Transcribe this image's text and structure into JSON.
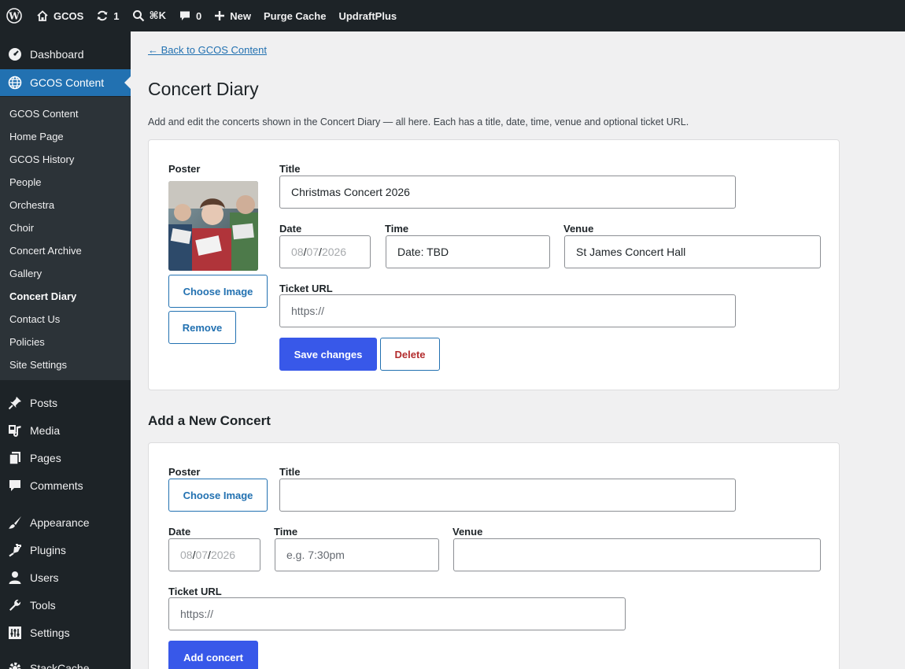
{
  "admin_bar": {
    "site_name": "GCOS",
    "updates_count": "1",
    "search_shortcut": "⌘K",
    "comments_count": "0",
    "new_label": "New",
    "purge_cache_label": "Purge Cache",
    "updraft_label": "UpdraftPlus"
  },
  "sidebar": {
    "dashboard": "Dashboard",
    "gcos_content": "GCOS Content",
    "submenu": [
      "GCOS Content",
      "Home Page",
      "GCOS History",
      "People",
      "Orchestra",
      "Choir",
      "Concert Archive",
      "Gallery",
      "Concert Diary",
      "Contact Us",
      "Policies",
      "Site Settings"
    ],
    "active_submenu": "Concert Diary",
    "menu": {
      "posts": "Posts",
      "media": "Media",
      "pages": "Pages",
      "comments": "Comments",
      "appearance": "Appearance",
      "plugins": "Plugins",
      "users": "Users",
      "tools": "Tools",
      "settings": "Settings",
      "stackcache": "StackCache"
    }
  },
  "page": {
    "back_link": "← Back to GCOS Content",
    "title": "Concert Diary",
    "description": "Add and edit the concerts shown in the Concert Diary — all here. Each has a title, date, time, venue and optional ticket URL."
  },
  "existing_concert": {
    "poster_label": "Poster",
    "title_label": "Title",
    "title_value": "Christmas Concert 2026",
    "date_label": "Date",
    "date_day": "08",
    "date_month": "07",
    "date_year": "2026",
    "time_label": "Time",
    "time_value": "Date: TBD",
    "venue_label": "Venue",
    "venue_value": "St James Concert Hall",
    "ticket_label": "Ticket URL",
    "ticket_placeholder": "https://",
    "choose_image": "Choose Image",
    "remove": "Remove",
    "save": "Save changes",
    "delete": "Delete"
  },
  "new_concert": {
    "section_title": "Add a New Concert",
    "poster_label": "Poster",
    "choose_image": "Choose Image",
    "title_label": "Title",
    "title_value": "",
    "date_label": "Date",
    "date_day": "08",
    "date_month": "07",
    "date_year": "2026",
    "time_label": "Time",
    "time_placeholder": "e.g. 7:30pm",
    "venue_label": "Venue",
    "venue_value": "",
    "ticket_label": "Ticket URL",
    "ticket_placeholder": "https://",
    "add_button": "Add concert"
  },
  "colors": {
    "admin_bg": "#1d2327",
    "accent": "#2271b1",
    "primary_button": "#3858e9",
    "danger_text": "#b32d2e"
  }
}
